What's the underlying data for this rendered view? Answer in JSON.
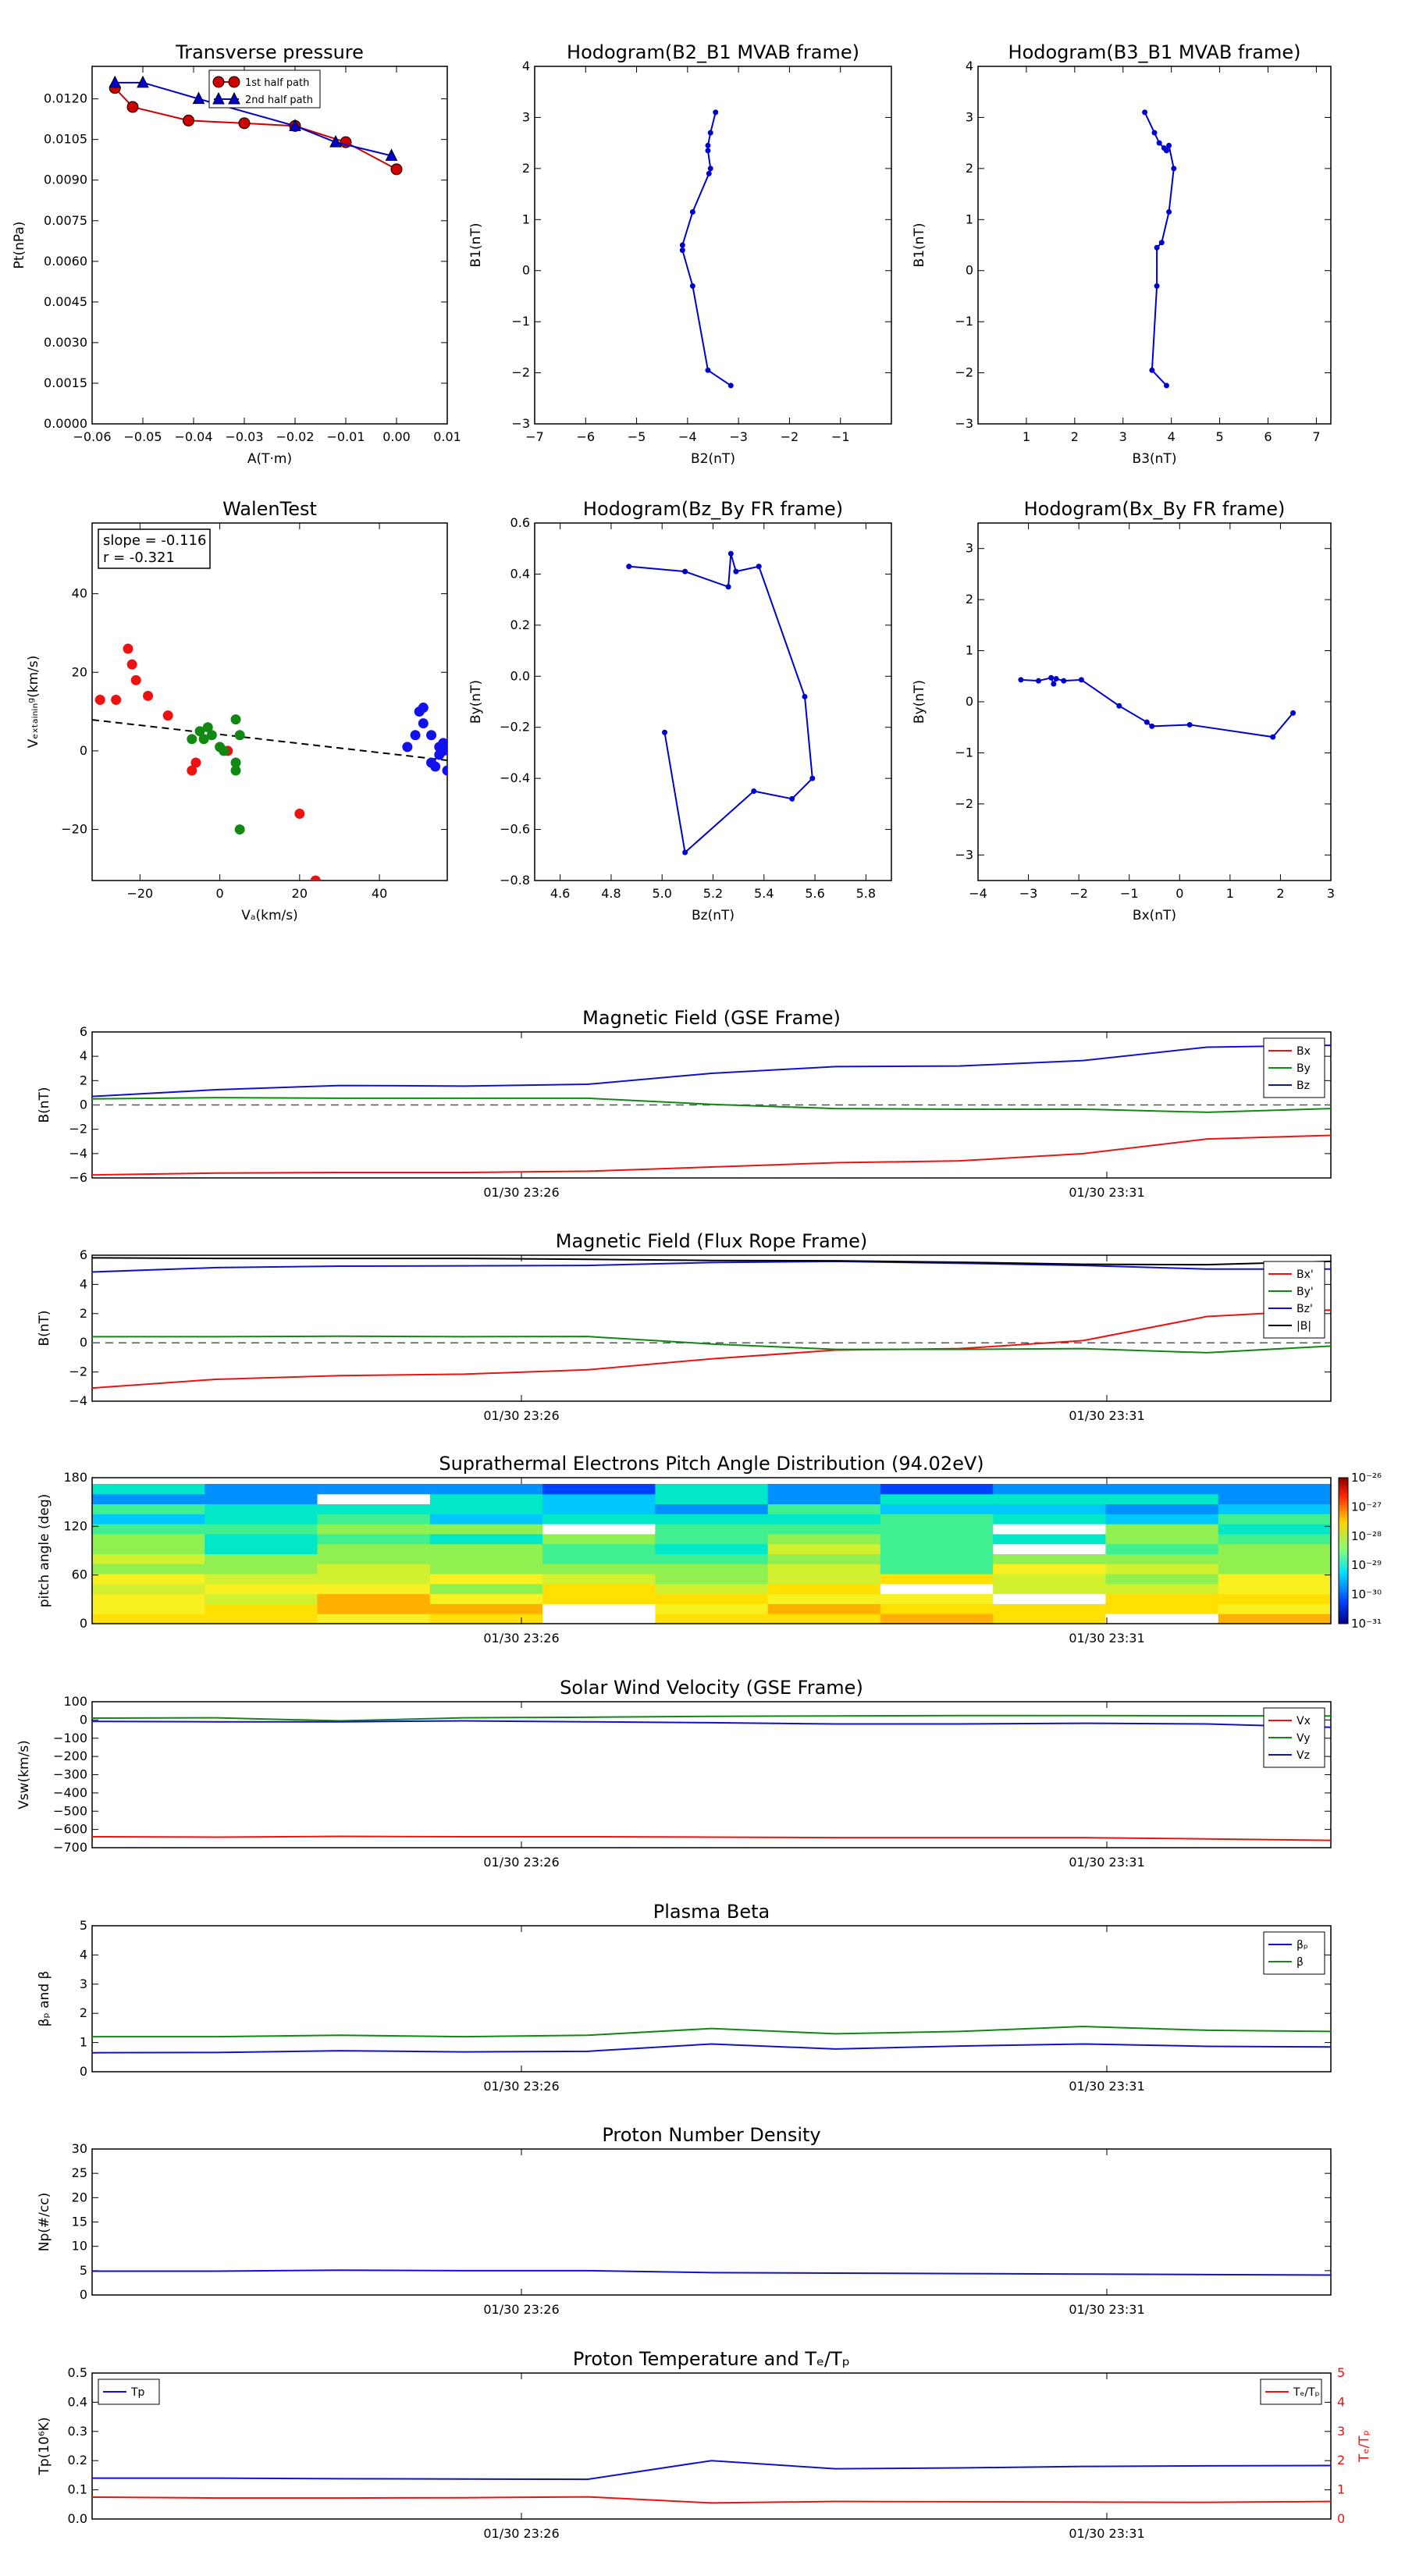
{
  "chart_data": [
    {
      "id": "tp",
      "type": "line",
      "title": "Transverse pressure",
      "xlabel": "A(T·m)",
      "ylabel": "Pt(nPa)",
      "xlim": [
        -0.06,
        0.01
      ],
      "ylim": [
        0.0,
        0.0132
      ],
      "xticks": [
        -0.06,
        -0.05,
        -0.04,
        -0.03,
        -0.02,
        -0.01,
        0.0,
        0.01
      ],
      "xtick_labels": [
        "−0.06",
        "−0.05",
        "−0.04",
        "−0.03",
        "−0.02",
        "−0.01",
        "0.00",
        "0.01"
      ],
      "yticks": [
        0.0,
        0.0015,
        0.003,
        0.0045,
        0.006,
        0.0075,
        0.009,
        0.0105,
        0.012
      ],
      "ytick_labels": [
        "0.0000",
        "0.0015",
        "0.0030",
        "0.0045",
        "0.0060",
        "0.0075",
        "0.0090",
        "0.0105",
        "0.0120"
      ],
      "legend": "top-center",
      "grid": false,
      "series": [
        {
          "name": "1st half path",
          "color": "#cc0000",
          "marker": "circle",
          "x": [
            -0.0555,
            -0.052,
            -0.041,
            -0.03,
            -0.02,
            -0.01,
            0.0
          ],
          "y": [
            0.0124,
            0.0117,
            0.0112,
            0.0111,
            0.011,
            0.0104,
            0.0094
          ]
        },
        {
          "name": "2nd half path",
          "color": "#0000cc",
          "marker": "triangle",
          "x": [
            -0.0555,
            -0.05,
            -0.039,
            -0.02,
            -0.012,
            -0.001
          ],
          "y": [
            0.0126,
            0.0126,
            0.012,
            0.011,
            0.0104,
            0.0099
          ]
        }
      ]
    },
    {
      "id": "hodo_b2b1",
      "type": "line",
      "title": "Hodogram(B2_B1 MVAB frame)",
      "xlabel": "B2(nT)",
      "ylabel": "B1(nT)",
      "xlim": [
        -7,
        0
      ],
      "ylim": [
        -3,
        4
      ],
      "xticks": [
        -7,
        -6,
        -5,
        -4,
        -3,
        -2,
        -1
      ],
      "xtick_labels": [
        "−7",
        "−6",
        "−5",
        "−4",
        "−3",
        "−2",
        "−1"
      ],
      "yticks": [
        -3,
        -2,
        -1,
        0,
        1,
        2,
        3,
        4
      ],
      "ytick_labels": [
        "−3",
        "−2",
        "−1",
        "0",
        "1",
        "2",
        "3",
        "4"
      ],
      "grid": false,
      "series": [
        {
          "color": "#0000cc",
          "marker": "dot",
          "x": [
            -3.45,
            -3.55,
            -3.6,
            -3.6,
            -3.55,
            -3.58,
            -3.9,
            -4.1,
            -4.1,
            -3.9,
            -3.6,
            -3.15
          ],
          "y": [
            3.1,
            2.7,
            2.45,
            2.35,
            2.0,
            1.9,
            1.15,
            0.5,
            0.4,
            -0.3,
            -1.95,
            -2.25
          ]
        }
      ]
    },
    {
      "id": "hodo_b3b1",
      "type": "line",
      "title": "Hodogram(B3_B1 MVAB frame)",
      "xlabel": "B3(nT)",
      "ylabel": "B1(nT)",
      "xlim": [
        0,
        7.3
      ],
      "ylim": [
        -3,
        4
      ],
      "xticks": [
        1,
        2,
        3,
        4,
        5,
        6,
        7
      ],
      "xtick_labels": [
        "1",
        "2",
        "3",
        "4",
        "5",
        "6",
        "7"
      ],
      "yticks": [
        -3,
        -2,
        -1,
        0,
        1,
        2,
        3,
        4
      ],
      "ytick_labels": [
        "−3",
        "−2",
        "−1",
        "0",
        "1",
        "2",
        "3",
        "4"
      ],
      "grid": false,
      "series": [
        {
          "color": "#0000cc",
          "marker": "dot",
          "x": [
            3.45,
            3.65,
            3.75,
            3.85,
            3.9,
            3.95,
            4.05,
            3.95,
            3.8,
            3.7,
            3.7,
            3.6,
            3.9
          ],
          "y": [
            3.1,
            2.7,
            2.5,
            2.4,
            2.35,
            2.45,
            2.0,
            1.15,
            0.55,
            0.45,
            -0.3,
            -1.95,
            -2.25
          ]
        }
      ]
    },
    {
      "id": "walen",
      "type": "scatter",
      "title": "WalenTest",
      "xlabel": "Vₐ(km/s)",
      "ylabel": "Vₑₓₜₐᵢₙᵢₙᵍ(km/s)",
      "xlim": [
        -32,
        57
      ],
      "ylim": [
        -33,
        58
      ],
      "xticks": [
        -20,
        0,
        20,
        40
      ],
      "xtick_labels": [
        "−20",
        "0",
        "20",
        "40"
      ],
      "yticks": [
        -20,
        0,
        20,
        40
      ],
      "ytick_labels": [
        "−20",
        "0",
        "20",
        "40"
      ],
      "grid": false,
      "annotation": {
        "line1": "slope = -0.116",
        "line2": "r = -0.321"
      },
      "fit": {
        "slope": -0.116,
        "intercept": 4.2,
        "color": "#000000",
        "style": "dashed"
      },
      "series": [
        {
          "color": "#ee1111",
          "x": [
            -30,
            -26,
            -23,
            -22,
            -21,
            -18,
            -13,
            -7,
            -6,
            2,
            20,
            24
          ],
          "y": [
            13,
            13,
            26,
            22,
            18,
            14,
            9,
            -5,
            -3,
            0,
            -16,
            -33
          ]
        },
        {
          "color": "#118811",
          "x": [
            -7,
            -5,
            -4,
            -3,
            -2,
            0,
            1,
            4,
            4,
            4,
            5,
            5
          ],
          "y": [
            3,
            5,
            3,
            6,
            4,
            1,
            0,
            -3,
            -5,
            8,
            4,
            -20
          ]
        },
        {
          "color": "#1111ee",
          "x": [
            47,
            49,
            50,
            51,
            51,
            53,
            53,
            54,
            55,
            55,
            56,
            57,
            56,
            57
          ],
          "y": [
            1,
            4,
            10,
            7,
            11,
            -3,
            4,
            -4,
            -1,
            1,
            2,
            -5,
            0,
            1
          ]
        }
      ]
    },
    {
      "id": "hodo_bzby",
      "type": "line",
      "title": "Hodogram(Bz_By FR frame)",
      "xlabel": "Bz(nT)",
      "ylabel": "By(nT)",
      "xlim": [
        4.5,
        5.9
      ],
      "ylim": [
        -0.8,
        0.6
      ],
      "xticks": [
        4.6,
        4.8,
        5.0,
        5.2,
        5.4,
        5.6,
        5.8
      ],
      "xtick_labels": [
        "4.6",
        "4.8",
        "5.0",
        "5.2",
        "5.4",
        "5.6",
        "5.8"
      ],
      "yticks": [
        -0.8,
        -0.6,
        -0.4,
        -0.2,
        0.0,
        0.2,
        0.4,
        0.6
      ],
      "ytick_labels": [
        "−0.8",
        "−0.6",
        "−0.4",
        "−0.2",
        "0.0",
        "0.2",
        "0.4",
        "0.6"
      ],
      "grid": false,
      "series": [
        {
          "color": "#0000cc",
          "marker": "dot",
          "x": [
            4.87,
            5.09,
            5.26,
            5.27,
            5.29,
            5.38,
            5.56,
            5.59,
            5.51,
            5.36,
            5.09,
            5.01
          ],
          "y": [
            0.43,
            0.41,
            0.35,
            0.48,
            0.41,
            0.43,
            -0.08,
            -0.4,
            -0.48,
            -0.45,
            -0.69,
            -0.22
          ]
        }
      ]
    },
    {
      "id": "hodo_bxby",
      "type": "line",
      "title": "Hodogram(Bx_By FR frame)",
      "xlabel": "Bx(nT)",
      "ylabel": "By(nT)",
      "xlim": [
        -4,
        3
      ],
      "ylim": [
        -3.5,
        3.5
      ],
      "xticks": [
        -4,
        -3,
        -2,
        -1,
        0,
        1,
        2,
        3
      ],
      "xtick_labels": [
        "−4",
        "−3",
        "−2",
        "−1",
        "0",
        "1",
        "2",
        "3"
      ],
      "yticks": [
        -3,
        -2,
        -1,
        0,
        1,
        2,
        3
      ],
      "ytick_labels": [
        "−3",
        "−2",
        "−1",
        "0",
        "1",
        "2",
        "3"
      ],
      "grid": false,
      "series": [
        {
          "color": "#0000cc",
          "marker": "dot",
          "x": [
            -3.15,
            -2.8,
            -2.55,
            -2.5,
            -2.45,
            -2.3,
            -1.95,
            -1.2,
            -0.65,
            -0.55,
            0.2,
            1.85,
            2.25
          ],
          "y": [
            0.43,
            0.41,
            0.47,
            0.35,
            0.45,
            0.41,
            0.43,
            -0.08,
            -0.4,
            -0.48,
            -0.45,
            -0.69,
            -0.22
          ]
        }
      ]
    },
    {
      "id": "mag_gse",
      "type": "line",
      "title": "Magnetic Field (GSE Frame)",
      "ylabel": "B(nT)",
      "xlabel": "",
      "time_ticks": [
        "01/30 23:26",
        "01/30 23:31"
      ],
      "ylim": [
        -6,
        6
      ],
      "yticks": [
        -6,
        -4,
        -2,
        0,
        2,
        4,
        6
      ],
      "ytick_labels": [
        "−6",
        "−4",
        "−2",
        "0",
        "2",
        "4",
        "6"
      ],
      "zero_line": true,
      "legend": "top-right",
      "series": [
        {
          "name": "Bx",
          "color": "#ee1111",
          "values": [
            -5.75,
            -5.6,
            -5.55,
            -5.55,
            -5.45,
            -5.1,
            -4.75,
            -4.6,
            -4.0,
            -2.8,
            -2.5
          ]
        },
        {
          "name": "By",
          "color": "#118811",
          "values": [
            0.5,
            0.6,
            0.55,
            0.55,
            0.55,
            0.05,
            -0.3,
            -0.35,
            -0.35,
            -0.6,
            -0.3
          ]
        },
        {
          "name": "Bz",
          "color": "#1111cc",
          "values": [
            0.7,
            1.25,
            1.6,
            1.55,
            1.7,
            2.6,
            3.15,
            3.2,
            3.65,
            4.75,
            4.9
          ]
        }
      ]
    },
    {
      "id": "mag_fr",
      "type": "line",
      "title": "Magnetic Field (Flux Rope Frame)",
      "ylabel": "B(nT)",
      "xlabel": "",
      "time_ticks": [
        "01/30 23:26",
        "01/30 23:31"
      ],
      "ylim": [
        -4,
        6
      ],
      "yticks": [
        -4,
        -2,
        0,
        2,
        4,
        6
      ],
      "ytick_labels": [
        "−4",
        "−2",
        "0",
        "2",
        "4",
        "6"
      ],
      "zero_line": true,
      "legend": "top-right",
      "series": [
        {
          "name": "Bx'",
          "color": "#ee1111",
          "values": [
            -3.1,
            -2.5,
            -2.25,
            -2.15,
            -1.85,
            -1.1,
            -0.5,
            -0.4,
            0.15,
            1.8,
            2.25
          ]
        },
        {
          "name": "By'",
          "color": "#118811",
          "values": [
            0.42,
            0.42,
            0.45,
            0.42,
            0.43,
            -0.08,
            -0.45,
            -0.45,
            -0.4,
            -0.68,
            -0.22
          ]
        },
        {
          "name": "Bz'",
          "color": "#1111cc",
          "values": [
            4.85,
            5.15,
            5.25,
            5.27,
            5.3,
            5.5,
            5.58,
            5.45,
            5.3,
            5.05,
            5.05
          ]
        },
        {
          "name": "|B|",
          "color": "#000000",
          "values": [
            5.82,
            5.78,
            5.78,
            5.78,
            5.72,
            5.64,
            5.62,
            5.52,
            5.38,
            5.35,
            5.58
          ]
        }
      ]
    },
    {
      "id": "pad",
      "type": "heatmap",
      "title": "Suprathermal Electrons Pitch Angle Distribution (94.02eV)",
      "ylabel": "pitch angle (deg)",
      "xlabel": "",
      "time_ticks": [
        "01/30 23:26",
        "01/30 23:31"
      ],
      "ylim": [
        0,
        180
      ],
      "yticks": [
        0,
        60,
        120,
        180
      ],
      "ytick_labels": [
        "0",
        "60",
        "120",
        "180"
      ],
      "colorbar": {
        "ticks": [
          "10⁻²⁶",
          "10⁻²⁷",
          "10⁻²⁸",
          "10⁻²⁹",
          "10⁻³⁰",
          "10⁻³¹"
        ]
      }
    },
    {
      "id": "vsw",
      "type": "line",
      "title": "Solar Wind Velocity (GSE Frame)",
      "ylabel": "Vsw(km/s)",
      "xlabel": "",
      "time_ticks": [
        "01/30 23:26",
        "01/30 23:31"
      ],
      "ylim": [
        -700,
        100
      ],
      "yticks": [
        -700,
        -600,
        -500,
        -400,
        -300,
        -200,
        -100,
        0,
        100
      ],
      "ytick_labels": [
        "−700",
        "−600",
        "−500",
        "−400",
        "−300",
        "−200",
        "−100",
        "0",
        "100"
      ],
      "legend": "top-right",
      "series": [
        {
          "name": "Vx",
          "color": "#ee1111",
          "values": [
            -640,
            -642,
            -638,
            -640,
            -640,
            -642,
            -645,
            -645,
            -645,
            -652,
            -660
          ]
        },
        {
          "name": "Vy",
          "color": "#118811",
          "values": [
            10,
            12,
            -5,
            12,
            15,
            20,
            22,
            24,
            24,
            23,
            22
          ]
        },
        {
          "name": "Vz",
          "color": "#1111cc",
          "values": [
            -8,
            -10,
            -10,
            -5,
            -10,
            -15,
            -22,
            -22,
            -18,
            -22,
            -40
          ]
        }
      ]
    },
    {
      "id": "beta",
      "type": "line",
      "title": "Plasma Beta",
      "ylabel": "βₚ and β",
      "xlabel": "",
      "time_ticks": [
        "01/30 23:26",
        "01/30 23:31"
      ],
      "ylim": [
        0,
        5
      ],
      "yticks": [
        0,
        1,
        2,
        3,
        4,
        5
      ],
      "ytick_labels": [
        "0",
        "1",
        "2",
        "3",
        "4",
        "5"
      ],
      "legend": "top-right",
      "series": [
        {
          "name": "βₚ",
          "color": "#1111cc",
          "values": [
            0.65,
            0.66,
            0.72,
            0.68,
            0.7,
            0.95,
            0.78,
            0.88,
            0.95,
            0.87,
            0.85
          ]
        },
        {
          "name": "β",
          "color": "#118811",
          "values": [
            1.2,
            1.2,
            1.25,
            1.2,
            1.25,
            1.48,
            1.3,
            1.38,
            1.55,
            1.42,
            1.38
          ]
        }
      ]
    },
    {
      "id": "np",
      "type": "line",
      "title": "Proton Number Density",
      "ylabel": "Np(#/cc)",
      "xlabel": "",
      "time_ticks": [
        "01/30 23:26",
        "01/30 23:31"
      ],
      "ylim": [
        0,
        30
      ],
      "yticks": [
        0,
        5,
        10,
        15,
        20,
        25,
        30
      ],
      "ytick_labels": [
        "0",
        "5",
        "10",
        "15",
        "20",
        "25",
        "30"
      ],
      "series": [
        {
          "color": "#1111cc",
          "values": [
            4.9,
            4.9,
            5.1,
            5.0,
            5.0,
            4.6,
            4.5,
            4.4,
            4.3,
            4.2,
            4.1
          ]
        }
      ]
    },
    {
      "id": "tpr",
      "type": "line",
      "title": "Proton Temperature and Tₑ/Tₚ",
      "ylabel": "Tp(10⁶K)",
      "ylabel_right": "Tₑ/Tₚ",
      "xlabel": "",
      "time_ticks": [
        "01/30 23:26",
        "01/30 23:31"
      ],
      "ylim": [
        0,
        0.5
      ],
      "yticks": [
        0,
        0.1,
        0.2,
        0.3,
        0.4,
        0.5
      ],
      "ytick_labels": [
        "0.0",
        "0.1",
        "0.2",
        "0.3",
        "0.4",
        "0.5"
      ],
      "ylim_right": [
        0,
        5
      ],
      "yticks_right": [
        0,
        1,
        2,
        3,
        4,
        5
      ],
      "ytick_labels_right": [
        "0",
        "1",
        "2",
        "3",
        "4",
        "5"
      ],
      "series": [
        {
          "name": "Tp",
          "color": "#1111cc",
          "axis": "left",
          "values": [
            0.14,
            0.14,
            0.138,
            0.137,
            0.136,
            0.2,
            0.172,
            0.175,
            0.18,
            0.182,
            0.183
          ]
        },
        {
          "name": "Tₑ/Tₚ",
          "color": "#ee1111",
          "axis": "right",
          "values": [
            0.75,
            0.72,
            0.72,
            0.73,
            0.76,
            0.55,
            0.6,
            0.59,
            0.58,
            0.57,
            0.6
          ]
        }
      ]
    }
  ]
}
